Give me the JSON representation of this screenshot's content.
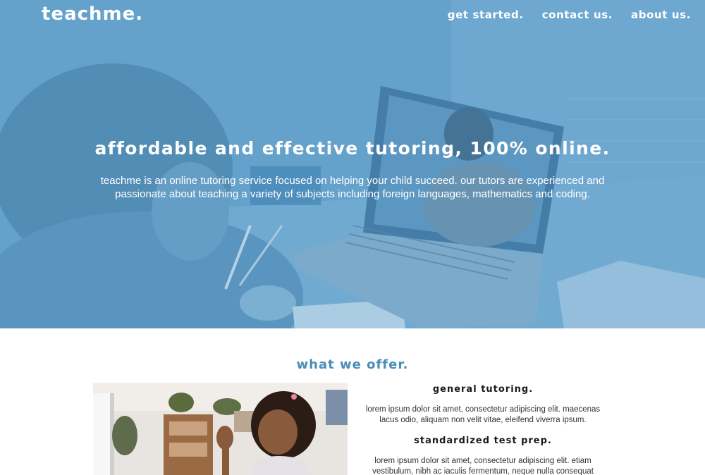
{
  "nav": {
    "logo": "teachme.",
    "links": [
      "get started.",
      "contact us.",
      "about us."
    ]
  },
  "hero": {
    "title": "affordable and effective tutoring, 100% online.",
    "subtitle": "teachme is an online tutoring service focused on helping your child succeed. our tutors are experienced and passionate about teaching a variety of subjects including foreign languages, mathematics and coding."
  },
  "offer": {
    "heading": "what we offer.",
    "items": [
      {
        "title": "general tutoring.",
        "description": "lorem ipsum dolor sit amet, consectetur adipiscing elit. maecenas lacus odio, aliquam non velit vitae, eleifend viverra ipsum."
      },
      {
        "title": "standardized test prep.",
        "description": "lorem ipsum dolor sit amet, consectetur adipiscing elit. etiam vestibulum, nibh ac iaculis fermentum, neque nulla consequat"
      }
    ]
  },
  "colors": {
    "hero_tint": "#5b9bc4",
    "accent": "#4a8db8",
    "text_white": "#ffffff"
  }
}
